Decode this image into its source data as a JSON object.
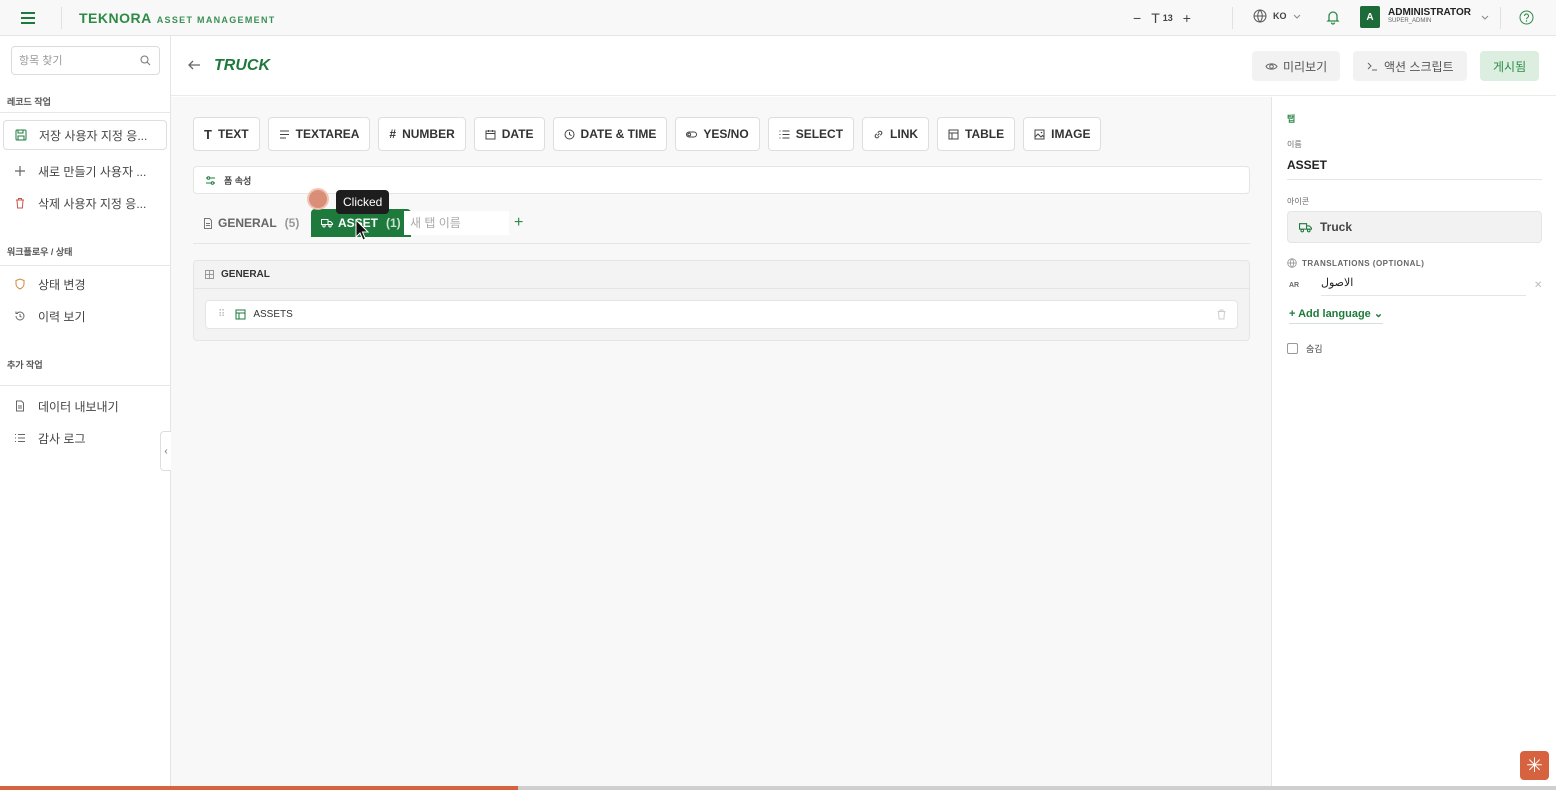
{
  "topbar": {
    "brand_name": "TEKNORA",
    "brand_sub": "ASSET MANAGEMENT",
    "font_size": "13",
    "language": "KO",
    "user_initial": "A",
    "user_name": "ADMINISTRATOR",
    "user_role": "SUPER_ADMIN"
  },
  "sidebar": {
    "search_placeholder": "항목 찾기",
    "sections": [
      {
        "title": "레코드 작업",
        "items": [
          {
            "label": "저장 사용자 지정 응...",
            "icon": "save-icon"
          },
          {
            "label": "새로 만들기 사용자 ...",
            "icon": "plus-icon"
          },
          {
            "label": "삭제 사용자 지정 응...",
            "icon": "trash-icon"
          }
        ]
      },
      {
        "title": "워크플로우 / 상태",
        "items": [
          {
            "label": "상태 변경",
            "icon": "shield-icon"
          },
          {
            "label": "이력 보기",
            "icon": "history-icon"
          }
        ]
      },
      {
        "title": "추가 작업",
        "items": [
          {
            "label": "데이터 내보내기",
            "icon": "document-icon"
          },
          {
            "label": "감사 로그",
            "icon": "list-icon"
          }
        ]
      }
    ]
  },
  "header": {
    "title": "TRUCK",
    "preview_label": "미리보기",
    "action_script_label": "액션 스크립트",
    "publish_label": "게시됨"
  },
  "field_types": [
    "TEXT",
    "TEXTAREA",
    "NUMBER",
    "DATE",
    "DATE & TIME",
    "YES/NO",
    "SELECT",
    "LINK",
    "TABLE",
    "IMAGE"
  ],
  "form_props_label": "폼 속성",
  "tabs": [
    {
      "label": "GENERAL",
      "count": "(5)"
    },
    {
      "label": "ASSET",
      "count": "(1)"
    }
  ],
  "new_tab_placeholder": "새 탭 이름",
  "section": {
    "title": "GENERAL",
    "rows": [
      {
        "label": "ASSETS"
      }
    ]
  },
  "overlay": {
    "tooltip": "Clicked"
  },
  "right_panel": {
    "tab_label": "탭",
    "name_label": "이름",
    "name_value": "ASSET",
    "icon_label": "아이콘",
    "icon_value": "Truck",
    "translations_label": "TRANSLATIONS (OPTIONAL)",
    "translation_code": "AR",
    "translation_value": "الاصول",
    "add_language": "+ Add language",
    "hide_label": "숨김"
  },
  "colors": {
    "accent": "#1e7a3c",
    "progress": "#d7623f"
  },
  "progress_fraction": 0.333
}
